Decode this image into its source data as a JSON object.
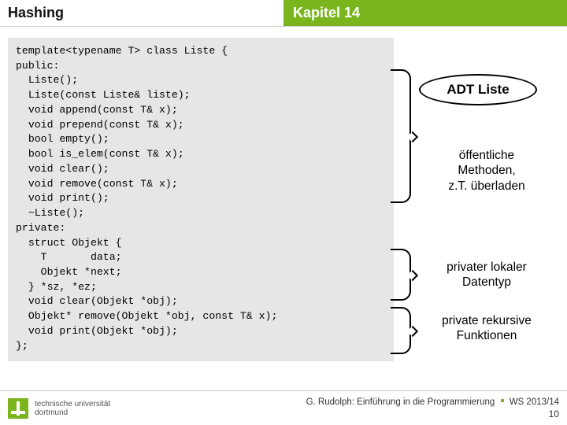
{
  "header": {
    "left": "Hashing",
    "right": "Kapitel 14"
  },
  "code": "template<typename T> class Liste {\npublic:\n  Liste();\n  Liste(const Liste& liste);\n  void append(const T& x);\n  void prepend(const T& x);\n  bool empty();\n  bool is_elem(const T& x);\n  void clear();\n  void remove(const T& x);\n  void print();\n  ~Liste();\nprivate:\n  struct Objekt {\n    T       data;\n    Objekt *next;\n  } *sz, *ez;\n  void clear(Objekt *obj);\n  Objekt* remove(Objekt *obj, const T& x);\n  void print(Objekt *obj);\n};",
  "annotations": {
    "title": "ADT Liste",
    "public_methods": "öffentliche\nMethoden,\nz.T. überladen",
    "private_type": "privater lokaler\nDatentyp",
    "private_funcs": "private rekursive\nFunktionen"
  },
  "footer": {
    "uni_line1": "technische universität",
    "uni_line2": "dortmund",
    "credit": "G. Rudolph: Einführung in die Programmierung",
    "term": "WS 2013/14",
    "page": "10"
  }
}
